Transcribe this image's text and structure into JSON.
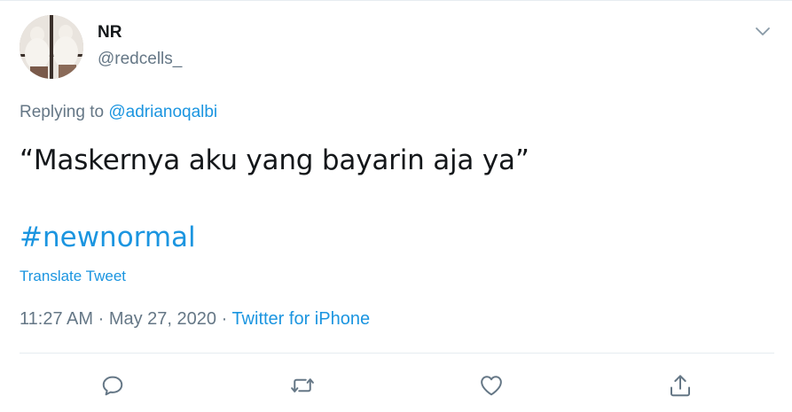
{
  "user": {
    "name": "NR",
    "handle": "@redcells_"
  },
  "reply": {
    "prefix": "Replying to ",
    "mention": "@adrianoqalbi"
  },
  "tweet": {
    "text": "“Maskernya aku yang bayarin aja ya”",
    "hashtag": "#newnormal",
    "translate_label": "Translate Tweet"
  },
  "meta": {
    "time": "11:27 AM",
    "separator1": " · ",
    "date": "May 27, 2020",
    "separator2": " · ",
    "source": "Twitter for iPhone"
  },
  "actions": [
    "reply-icon",
    "retweet-icon",
    "like-icon",
    "share-icon"
  ],
  "colors": {
    "link": "#1b95e0",
    "secondary_text": "#657786",
    "primary_text": "#14171a",
    "divider": "#e6ecf0"
  }
}
